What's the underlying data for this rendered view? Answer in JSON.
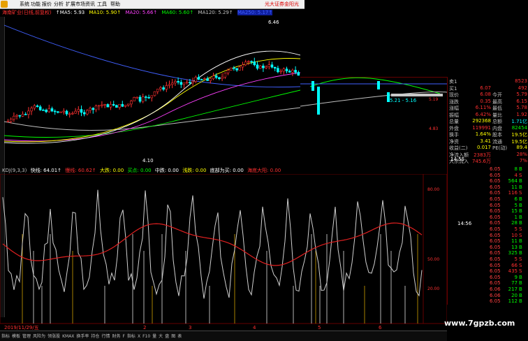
{
  "menu": {
    "items": [
      "系统",
      "功能",
      "报价",
      "分析",
      "扩展市场",
      "资讯",
      "工具",
      "帮助"
    ],
    "brand": "光大证券金阳光"
  },
  "ma_row": [
    {
      "text": "海南矿业(日线,前复权)",
      "color": "#ff3030"
    },
    {
      "text": "↑MA5: 5.93",
      "color": "#ffffff"
    },
    {
      "text": "MA10: 5.90↑",
      "color": "#ffff00"
    },
    {
      "text": "MA20: 5.66↑",
      "color": "#ff40ff"
    },
    {
      "text": "MA60: 5.60↑",
      "color": "#00ff00"
    },
    {
      "text": "MA120: 5.29↑",
      "color": "#c0c0c0"
    },
    {
      "text": "MA250: 5.17↑",
      "color": "#4060ff"
    }
  ],
  "price_labels": {
    "high": "6.46",
    "low": "4.10",
    "range": "5.21 - 5.16"
  },
  "price_axis": [
    "5.19",
    "4.83"
  ],
  "ind_row": [
    {
      "text": "KDJ(9,3,3)",
      "color": "#c0c0c0"
    },
    {
      "text": "快线: 64.01↑",
      "color": "#ffffff"
    },
    {
      "text": "慢线: 60.62↑",
      "color": "#ff3030"
    },
    {
      "text": "大跌: 0.00",
      "color": "#ffff00"
    },
    {
      "text": "买点: 0.00",
      "color": "#00ff00"
    },
    {
      "text": "中跌: 0.00",
      "color": "#ffffff"
    },
    {
      "text": "浅跌: 0.00",
      "color": "#ffff00"
    },
    {
      "text": "底部为买: 0.00",
      "color": "#ffffff"
    },
    {
      "text": "海底大阳: 0.00",
      "color": "#ff3030"
    }
  ],
  "ind_axis": [
    "80.00",
    "50.00",
    "20.00"
  ],
  "bottom_axis": [
    "2",
    "3",
    "4",
    "5",
    "6"
  ],
  "date_label": "2019/11/29/五",
  "tabs": [
    "指标",
    "模板",
    "管理",
    "风险为",
    "领涨股",
    "KMAX",
    "换手率",
    "持仓",
    "行情",
    "财务",
    "F",
    "指标",
    "X",
    "F10",
    "量",
    "大",
    "盘",
    "图",
    "表"
  ],
  "quote": {
    "rows": [
      {
        "l1": "卖1",
        "v1": "",
        "l2": "",
        "v2": "8523",
        "c1": "#c0c0c0",
        "c2": "#ff3030"
      },
      {
        "l1": "买1",
        "v1": "6.07",
        "l2": "",
        "v2": "492",
        "c1": "#ff3030",
        "c2": "#ff3030"
      },
      {
        "l1": "现价",
        "v1": "6.08",
        "l2": "今开",
        "v2": "5.79",
        "c1": "#ff3030",
        "c2": "#ff3030"
      },
      {
        "l1": "涨跌",
        "v1": "0.35",
        "l2": "最高",
        "v2": "6.15",
        "c1": "#ff3030",
        "c2": "#ff3030"
      },
      {
        "l1": "涨幅",
        "v1": "6.11%",
        "l2": "最低",
        "v2": "5.78",
        "c1": "#ff3030",
        "c2": "#ff3030"
      },
      {
        "l1": "振幅",
        "v1": "6.42%",
        "l2": "量比",
        "v2": "1.92",
        "c1": "#ff3030",
        "c2": "#ff3030"
      },
      {
        "l1": "总量",
        "v1": "292368",
        "l2": "总额",
        "v2": "1.71亿",
        "c1": "#ffff00",
        "c2": "#00ffff"
      },
      {
        "l1": "外盘",
        "v1": "119991",
        "l2": "内盘",
        "v2": "82454",
        "c1": "#ff3030",
        "c2": "#00ff00"
      },
      {
        "l1": "换手",
        "v1": "1.64%",
        "l2": "股本",
        "v2": "19.5亿",
        "c1": "#ffff00",
        "c2": "#ffff00"
      },
      {
        "l1": "净资",
        "v1": "3.41",
        "l2": "流通",
        "v2": "19.5亿",
        "c1": "#ffff00",
        "c2": "#ffff00"
      },
      {
        "l1": "收益(二)",
        "v1": "0.017",
        "l2": "PE(动)",
        "v2": "89.4",
        "c1": "#ffff00",
        "c2": "#ffff00"
      },
      {
        "l1": "净流入额",
        "v1": "2383万",
        "l2": "",
        "v2": "28%",
        "c1": "#ff3030",
        "c2": "#ff3030"
      },
      {
        "l1": "大宗流入",
        "v1": "745.6万",
        "l2": "",
        "v2": "7%",
        "c1": "#ff3030",
        "c2": "#ff3030"
      }
    ]
  },
  "ticks": {
    "time1": "14:55",
    "time2": "14:56",
    "rows": [
      {
        "p": "6.05",
        "q": "8",
        "d": "B"
      },
      {
        "p": "6.05",
        "q": "4",
        "d": "S"
      },
      {
        "p": "6.05",
        "q": "564",
        "d": "B"
      },
      {
        "p": "6.05",
        "q": "11",
        "d": "B"
      },
      {
        "p": "6.05",
        "q": "116",
        "d": "S"
      },
      {
        "p": "6.05",
        "q": "6",
        "d": "B"
      },
      {
        "p": "6.05",
        "q": "5",
        "d": "B"
      },
      {
        "p": "6.05",
        "q": "15",
        "d": "B"
      },
      {
        "p": "6.05",
        "q": "1",
        "d": "B"
      },
      {
        "p": "6.05",
        "q": "28",
        "d": "B"
      },
      {
        "p": "6.05",
        "q": "5",
        "d": "S"
      },
      {
        "p": "6.05",
        "q": "10",
        "d": "S"
      },
      {
        "p": "6.05",
        "q": "11",
        "d": "B"
      },
      {
        "p": "6.05",
        "q": "13",
        "d": "B"
      },
      {
        "p": "6.05",
        "q": "325",
        "d": "B"
      },
      {
        "p": "6.05",
        "q": "5",
        "d": "S"
      },
      {
        "p": "6.05",
        "q": "66",
        "d": "S"
      },
      {
        "p": "6.05",
        "q": "435",
        "d": "S"
      },
      {
        "p": "6.05",
        "q": "9",
        "d": "B"
      },
      {
        "p": "6.05",
        "q": "77",
        "d": "B"
      },
      {
        "p": "6.06",
        "q": "217",
        "d": "B"
      },
      {
        "p": "6.06",
        "q": "20",
        "d": "B"
      },
      {
        "p": "6.05",
        "q": "112",
        "d": "B"
      }
    ]
  },
  "watermark": "www.7gpzb.com",
  "colors": {
    "up": "#ff3030",
    "down": "#00ffff",
    "ma5": "#ffffff",
    "ma10": "#ffff00",
    "ma20": "#ff40ff",
    "ma60": "#00ff00",
    "ma120": "#c0c0c0",
    "ma250": "#4060ff"
  }
}
